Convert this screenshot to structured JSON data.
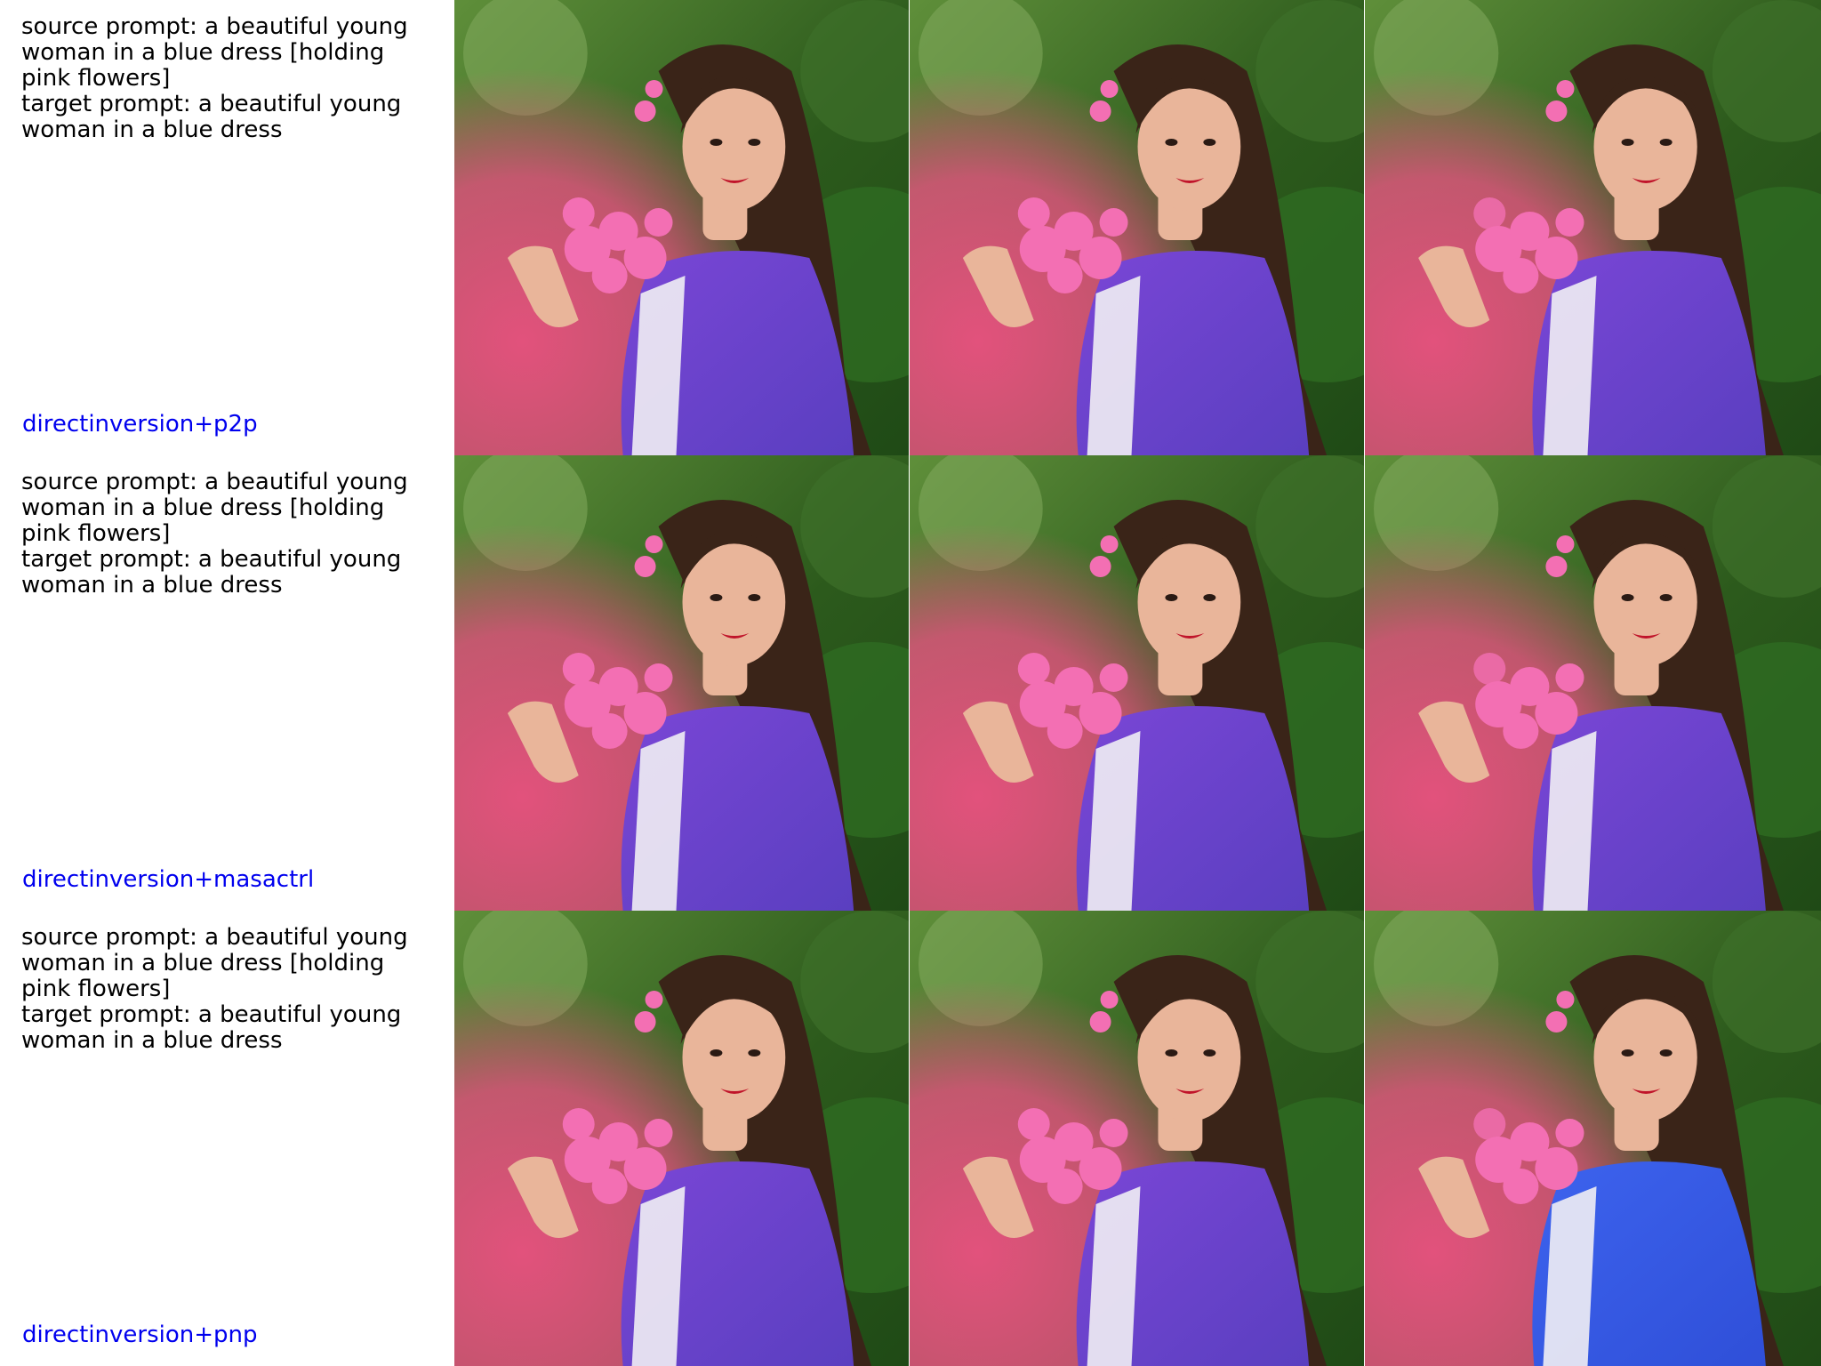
{
  "rows": [
    {
      "source_prompt": "source prompt: a beautiful young woman in a blue dress [holding pink flowers]",
      "target_prompt": "target prompt: a beautiful young woman in a blue dress",
      "method": "directinversion+p2p"
    },
    {
      "source_prompt": "source prompt: a beautiful young woman in a blue dress [holding pink flowers]",
      "target_prompt": "target prompt: a beautiful young woman in a blue dress",
      "method": "directinversion+masactrl"
    },
    {
      "source_prompt": "source prompt: a beautiful young woman in a blue dress [holding pink flowers]",
      "target_prompt": "target prompt: a beautiful young woman in a blue dress",
      "method": "directinversion+pnp"
    }
  ],
  "colors": {
    "method_label": "#0000ee",
    "foliage_dark": "#2c5a1c",
    "foliage_light": "#5f8f3a",
    "smoke_pink": "#e2527c",
    "dress_blue": "#5a3fc0",
    "dress_blue_pnp": "#2f4fd8",
    "flowers": "#f36fb3",
    "hair": "#3a2418",
    "skin": "#e9b59a"
  },
  "icons": [
    "woman-photo"
  ]
}
